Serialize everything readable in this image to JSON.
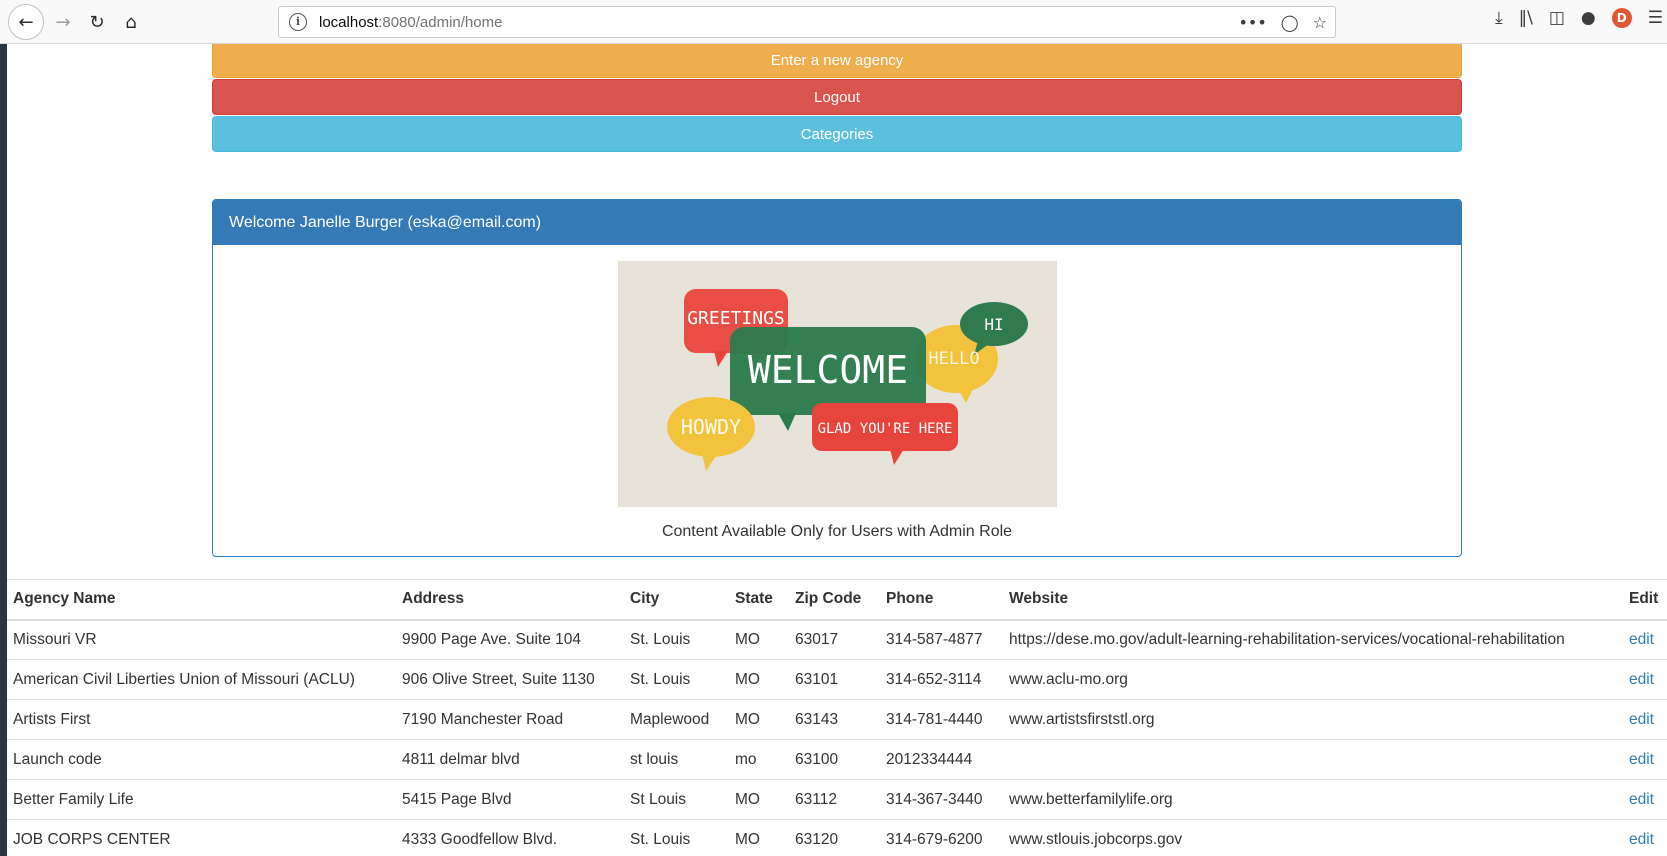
{
  "browser": {
    "url_host": "localhost",
    "url_path": ":8080/admin/home"
  },
  "actions": {
    "new_agency": "Enter a new agency",
    "logout": "Logout",
    "categories": "Categories"
  },
  "panel": {
    "heading": "Welcome Janelle Burger (eska@email.com)",
    "caption": "Content Available Only for Users with Admin Role",
    "image_words": {
      "greetings": "GREETINGS",
      "welcome": "WELCOME",
      "hi": "HI",
      "hello": "HELLO",
      "howdy": "HOWDY",
      "glad": "GLAD YOU'RE HERE"
    }
  },
  "table": {
    "headers": [
      "Agency Name",
      "Address",
      "City",
      "State",
      "Zip Code",
      "Phone",
      "Website",
      "Edit"
    ],
    "rows": [
      [
        "Missouri VR",
        "9900 Page Ave. Suite 104",
        "St. Louis",
        "MO",
        "63017",
        "314-587-4877",
        "https://dese.mo.gov/adult-learning-rehabilitation-services/vocational-rehabilitation",
        "edit"
      ],
      [
        "American Civil Liberties Union of Missouri (ACLU)",
        "906 Olive Street, Suite 1130",
        "St. Louis",
        "MO",
        "63101",
        "314-652-3114",
        "www.aclu-mo.org",
        "edit"
      ],
      [
        "Artists First",
        "7190 Manchester Road",
        "Maplewood",
        "MO",
        "63143",
        "314-781-4440",
        "www.artistsfirststl.org",
        "edit"
      ],
      [
        "Launch code",
        "4811 delmar blvd",
        "st louis",
        "mo",
        "63100",
        "2012334444",
        "",
        "edit"
      ],
      [
        "Better Family Life",
        "5415 Page Blvd",
        "St Louis",
        "MO",
        "63112",
        "314-367-3440",
        "www.betterfamilylife.org",
        "edit"
      ],
      [
        "JOB CORPS CENTER",
        "4333 Goodfellow Blvd.",
        "St. Louis",
        "MO",
        "63120",
        "314-679-6200",
        "www.stlouis.jobcorps.gov",
        "edit"
      ]
    ]
  },
  "colors": {
    "warning": "#f0ad4e",
    "danger": "#d9534f",
    "info": "#5bc0de",
    "primary": "#337ab7"
  }
}
